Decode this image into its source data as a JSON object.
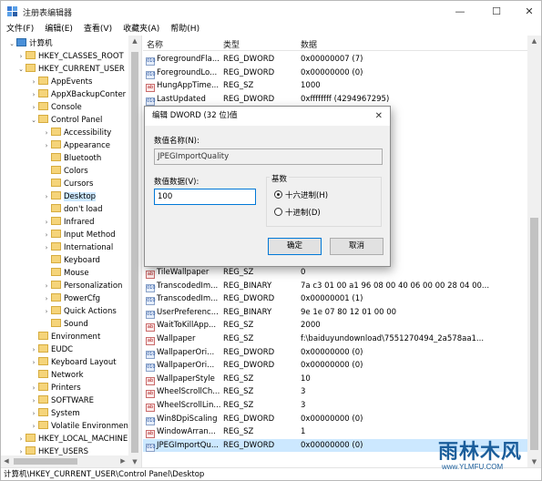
{
  "titlebar": {
    "title": "注册表编辑器",
    "min": "—",
    "max": "☐",
    "close": "✕"
  },
  "menu": [
    "文件(F)",
    "编辑(E)",
    "查看(V)",
    "收藏夹(A)",
    "帮助(H)"
  ],
  "tree": [
    {
      "label": "计算机",
      "exp": "⌄",
      "icon": "pc"
    },
    {
      "label": "HKEY_CLASSES_ROOT",
      "exp": "›",
      "icon": "folder"
    },
    {
      "label": "HKEY_CURRENT_USER",
      "exp": "⌄",
      "icon": "folder"
    },
    {
      "label": "AppEvents",
      "exp": "›",
      "icon": "folder"
    },
    {
      "label": "AppXBackupConter",
      "exp": "›",
      "icon": "folder"
    },
    {
      "label": "Console",
      "exp": "›",
      "icon": "folder"
    },
    {
      "label": "Control Panel",
      "exp": "⌄",
      "icon": "folder"
    },
    {
      "label": "Accessibility",
      "exp": "›",
      "icon": "folder"
    },
    {
      "label": "Appearance",
      "exp": "›",
      "icon": "folder"
    },
    {
      "label": "Bluetooth",
      "exp": "",
      "icon": "folder"
    },
    {
      "label": "Colors",
      "exp": "",
      "icon": "folder"
    },
    {
      "label": "Cursors",
      "exp": "",
      "icon": "folder"
    },
    {
      "label": "Desktop",
      "exp": "›",
      "icon": "folder",
      "selected": true
    },
    {
      "label": "don't load",
      "exp": "",
      "icon": "folder"
    },
    {
      "label": "Infrared",
      "exp": "›",
      "icon": "folder"
    },
    {
      "label": "Input Method",
      "exp": "›",
      "icon": "folder"
    },
    {
      "label": "International",
      "exp": "›",
      "icon": "folder"
    },
    {
      "label": "Keyboard",
      "exp": "",
      "icon": "folder"
    },
    {
      "label": "Mouse",
      "exp": "",
      "icon": "folder"
    },
    {
      "label": "Personalization",
      "exp": "›",
      "icon": "folder"
    },
    {
      "label": "PowerCfg",
      "exp": "›",
      "icon": "folder"
    },
    {
      "label": "Quick Actions",
      "exp": "›",
      "icon": "folder"
    },
    {
      "label": "Sound",
      "exp": "",
      "icon": "folder"
    },
    {
      "label": "Environment",
      "exp": "",
      "icon": "folder"
    },
    {
      "label": "EUDC",
      "exp": "›",
      "icon": "folder"
    },
    {
      "label": "Keyboard Layout",
      "exp": "›",
      "icon": "folder"
    },
    {
      "label": "Network",
      "exp": "",
      "icon": "folder"
    },
    {
      "label": "Printers",
      "exp": "›",
      "icon": "folder"
    },
    {
      "label": "SOFTWARE",
      "exp": "›",
      "icon": "folder"
    },
    {
      "label": "System",
      "exp": "›",
      "icon": "folder"
    },
    {
      "label": "Volatile Environmen",
      "exp": "›",
      "icon": "folder"
    },
    {
      "label": "HKEY_LOCAL_MACHINE",
      "exp": "›",
      "icon": "folder"
    },
    {
      "label": "HKEY_USERS",
      "exp": "›",
      "icon": "folder"
    }
  ],
  "list": {
    "headers": {
      "name": "名称",
      "type": "类型",
      "data": "数据"
    },
    "rows": [
      {
        "name": "ForegroundFla...",
        "type": "REG_DWORD",
        "data": "0x00000007 (7)",
        "kind": "bin"
      },
      {
        "name": "ForegroundLo...",
        "type": "REG_DWORD",
        "data": "0x00000000 (0)",
        "kind": "bin"
      },
      {
        "name": "HungAppTime...",
        "type": "REG_SZ",
        "data": "1000",
        "kind": "sz"
      },
      {
        "name": "LastUpdated",
        "type": "REG_DWORD",
        "data": "0xffffffff (4294967295)",
        "kind": "bin"
      },
      {
        "name": "TileWallpaper",
        "type": "REG_SZ",
        "data": "0",
        "kind": "sz",
        "after_dialog": true
      },
      {
        "name": "TranscodedIm...",
        "type": "REG_BINARY",
        "data": "7a c3 01 00 a1 96 08 00 40 06 00 00 28 04 00...",
        "kind": "bin"
      },
      {
        "name": "TranscodedIm...",
        "type": "REG_DWORD",
        "data": "0x00000001 (1)",
        "kind": "bin"
      },
      {
        "name": "UserPreferenc...",
        "type": "REG_BINARY",
        "data": "9e 1e 07 80 12 01 00 00",
        "kind": "bin"
      },
      {
        "name": "WaitToKillApp...",
        "type": "REG_SZ",
        "data": "2000",
        "kind": "sz"
      },
      {
        "name": "Wallpaper",
        "type": "REG_SZ",
        "data": "f:\\baiduyundownload\\7551270494_2a578aa1...",
        "kind": "sz"
      },
      {
        "name": "WallpaperOri...",
        "type": "REG_DWORD",
        "data": "0x00000000 (0)",
        "kind": "bin"
      },
      {
        "name": "WallpaperOri...",
        "type": "REG_DWORD",
        "data": "0x00000000 (0)",
        "kind": "bin"
      },
      {
        "name": "WallpaperStyle",
        "type": "REG_SZ",
        "data": "10",
        "kind": "sz"
      },
      {
        "name": "WheelScrollCh...",
        "type": "REG_SZ",
        "data": "3",
        "kind": "sz"
      },
      {
        "name": "WheelScrollLin...",
        "type": "REG_SZ",
        "data": "3",
        "kind": "sz"
      },
      {
        "name": "Win8DpiScaling",
        "type": "REG_DWORD",
        "data": "0x00000000 (0)",
        "kind": "bin"
      },
      {
        "name": "WindowArran...",
        "type": "REG_SZ",
        "data": "1",
        "kind": "sz"
      },
      {
        "name": "JPEGImportQu...",
        "type": "REG_DWORD",
        "data": "0x00000000 (0)",
        "kind": "bin",
        "selected": true
      }
    ]
  },
  "statusbar": "计算机\\HKEY_CURRENT_USER\\Control Panel\\Desktop",
  "dialog": {
    "title": "编辑 DWORD (32 位)值",
    "close": "✕",
    "name_label": "数值名称(N):",
    "name_value": "JPEGImportQuality",
    "data_label": "数值数据(V):",
    "data_value": "100",
    "base_label": "基数",
    "hex_label": "十六进制(H)",
    "dec_label": "十进制(D)",
    "ok": "确定",
    "cancel": "取消"
  },
  "watermark": {
    "line1": "雨林木风",
    "line2": "www.YLMFU.COM"
  },
  "icons": {
    "binary": "010",
    "string": "ab"
  }
}
